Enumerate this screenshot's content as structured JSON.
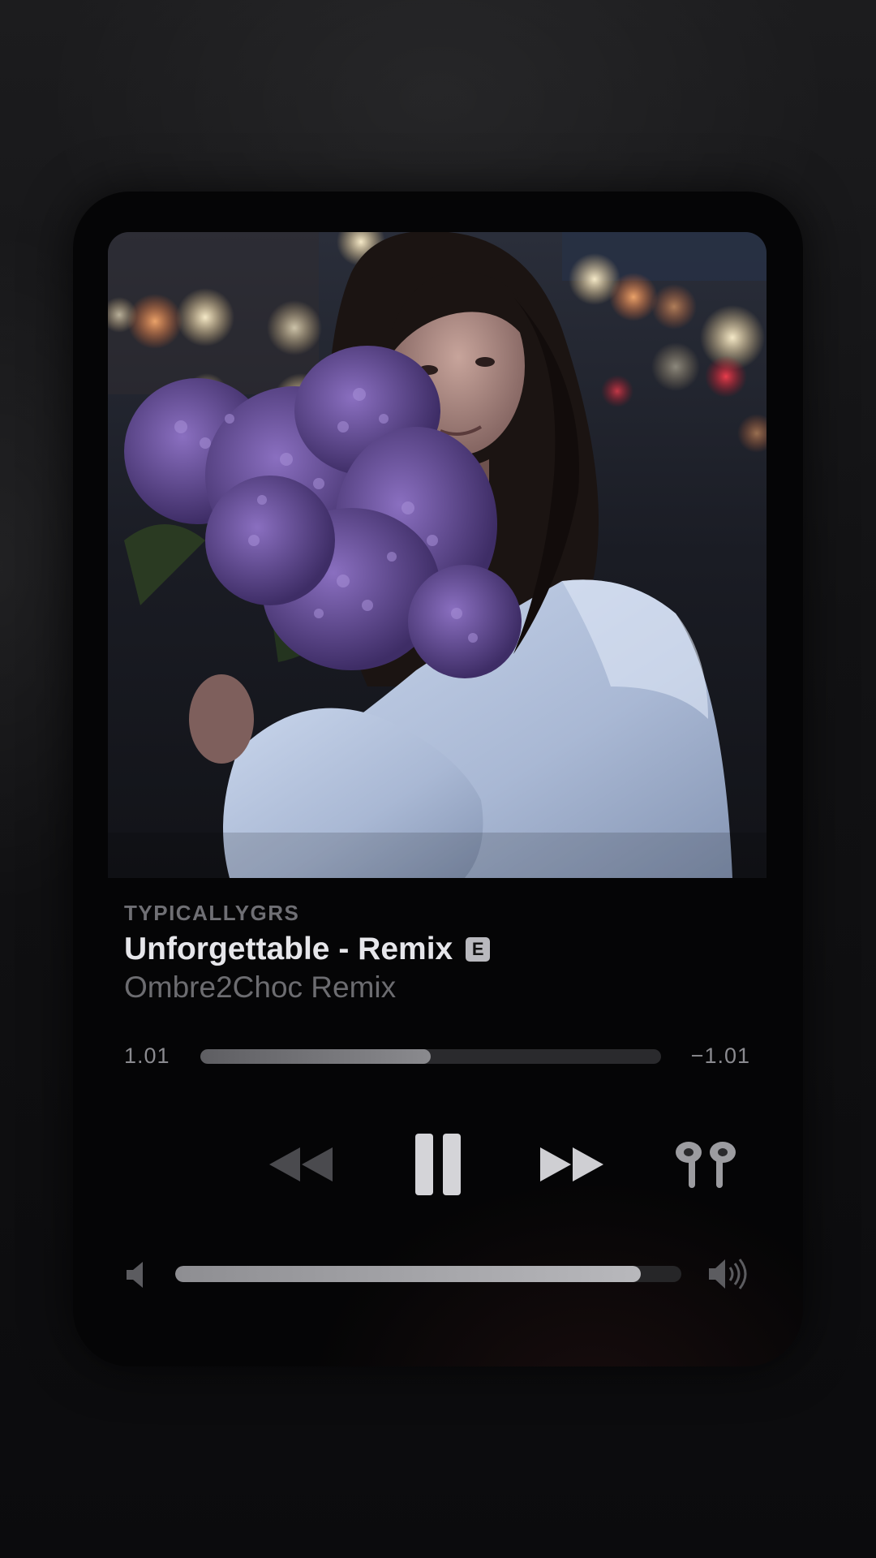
{
  "now_playing": {
    "artist": "TYPICALLYGRS",
    "title": "Unforgettable - Remix",
    "explicit_badge": "E",
    "subtitle": "Ombre2Choc Remix",
    "artwork_icon": "album-art-woman-holding-lilacs"
  },
  "progress": {
    "elapsed": "1.01",
    "remaining": "−1.01",
    "fraction": 0.5
  },
  "controls": {
    "rewind_icon": "rewind-icon",
    "pause_icon": "pause-icon",
    "forward_icon": "fast-forward-icon",
    "output_icon": "airpods-icon"
  },
  "volume": {
    "fraction": 0.92,
    "low_icon": "speaker-low-icon",
    "high_icon": "speaker-high-icon"
  },
  "colors": {
    "background": "#0c0c0e",
    "card": "#050506",
    "title": "#e6e6ea",
    "secondary": "#6c6c70"
  }
}
